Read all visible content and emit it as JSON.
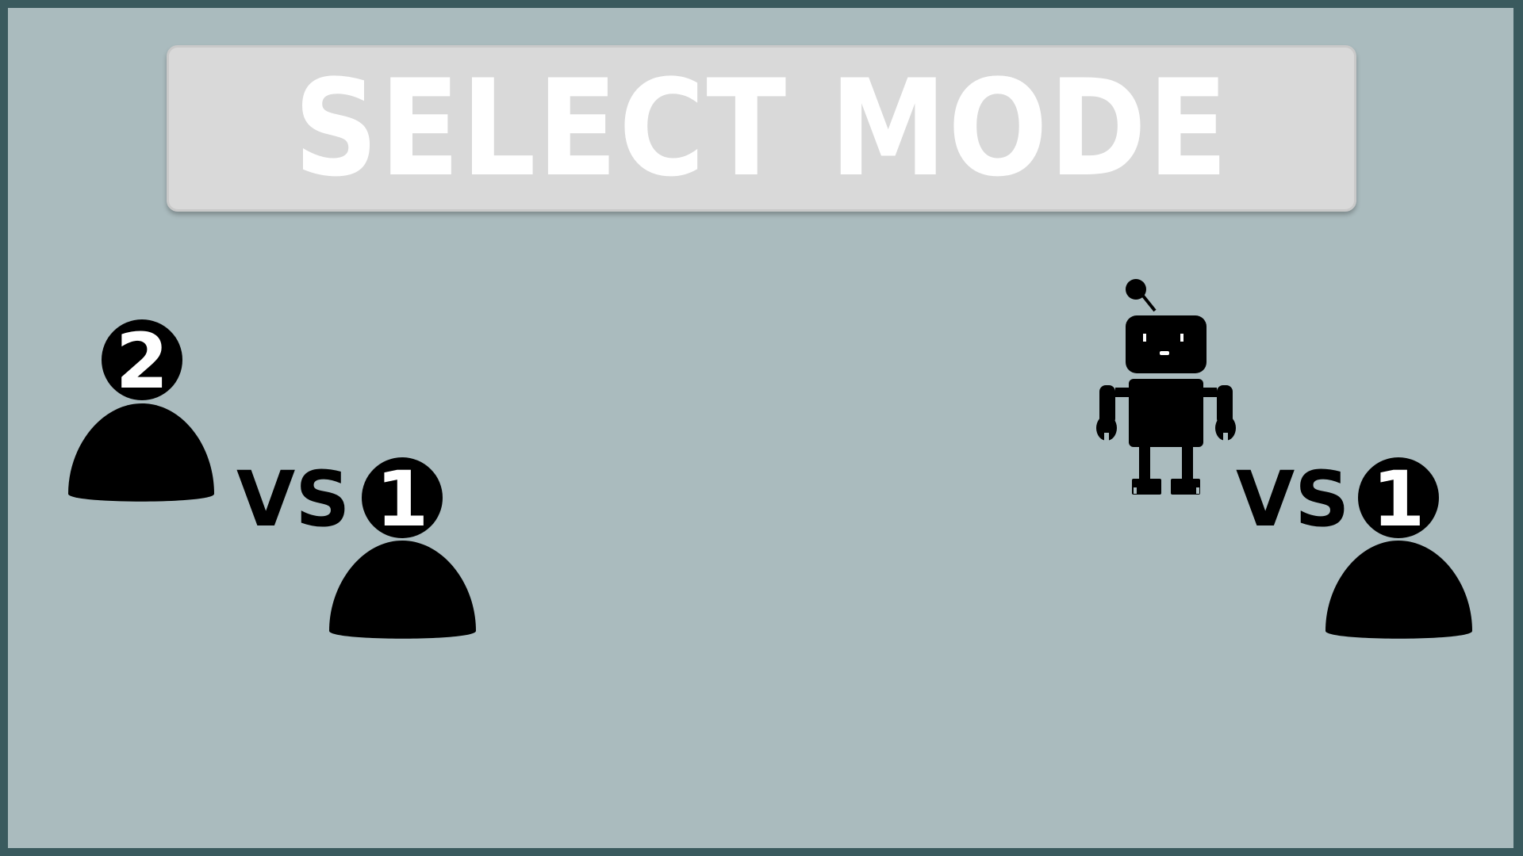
{
  "title": "SELECT MODE",
  "colors": {
    "outer_border": "#3a5a5e",
    "background": "#aabbbe",
    "title_panel": "#d9d9d9",
    "title_text": "#ffffff",
    "icon": "#000000"
  },
  "modes": [
    {
      "id": "two-player",
      "vs_label": "VS",
      "left_badge": "2",
      "right_badge": "1",
      "left_icon": "player-two-icon",
      "right_icon": "player-one-icon"
    },
    {
      "id": "vs-computer",
      "vs_label": "VS",
      "right_badge": "1",
      "left_icon": "robot-icon",
      "right_icon": "player-one-icon"
    }
  ]
}
